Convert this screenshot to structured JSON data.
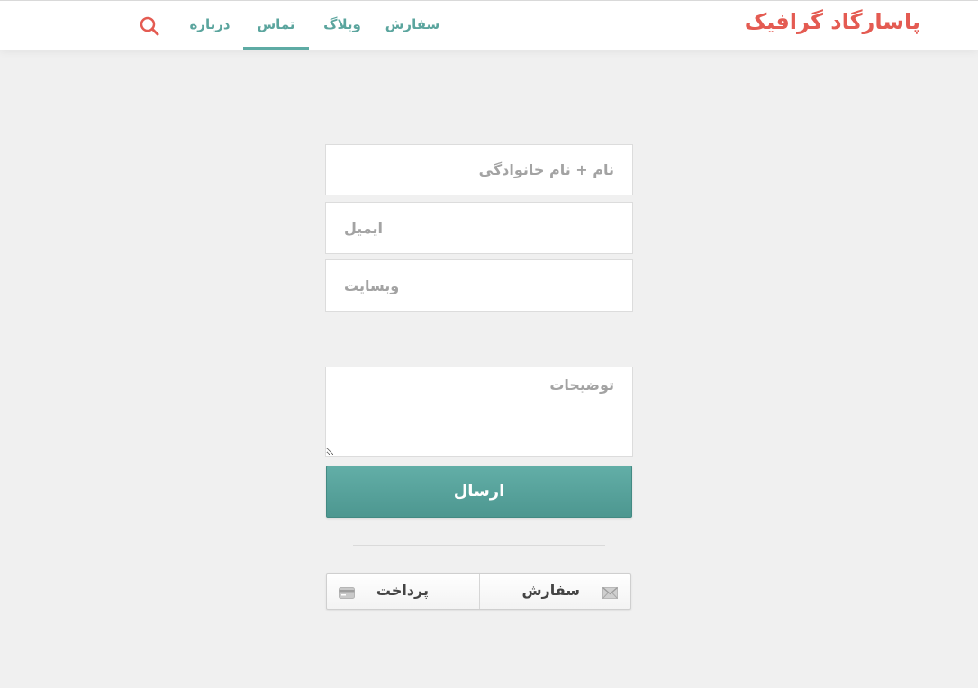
{
  "header": {
    "brand": "پاسارگاد گرافیک",
    "nav": [
      {
        "label": "سفارش"
      },
      {
        "label": "وبلاگ"
      },
      {
        "label": "تماس"
      },
      {
        "label": "درباره"
      }
    ],
    "active_item": "تماس"
  },
  "form": {
    "name_placeholder": "نام + نام خانوادگی",
    "email_placeholder": "ایمیل",
    "website_placeholder": "وبسایت",
    "description_placeholder": "توضیحات",
    "submit_label": "ارسال"
  },
  "actions": {
    "order_label": "سفارش",
    "order_icon": "envelope-icon",
    "payment_label": "پرداخت",
    "payment_icon": "credit-card-icon"
  },
  "colors": {
    "brand": "#e45b52",
    "accent": "#5eaba4",
    "background": "#f0f0f0"
  }
}
